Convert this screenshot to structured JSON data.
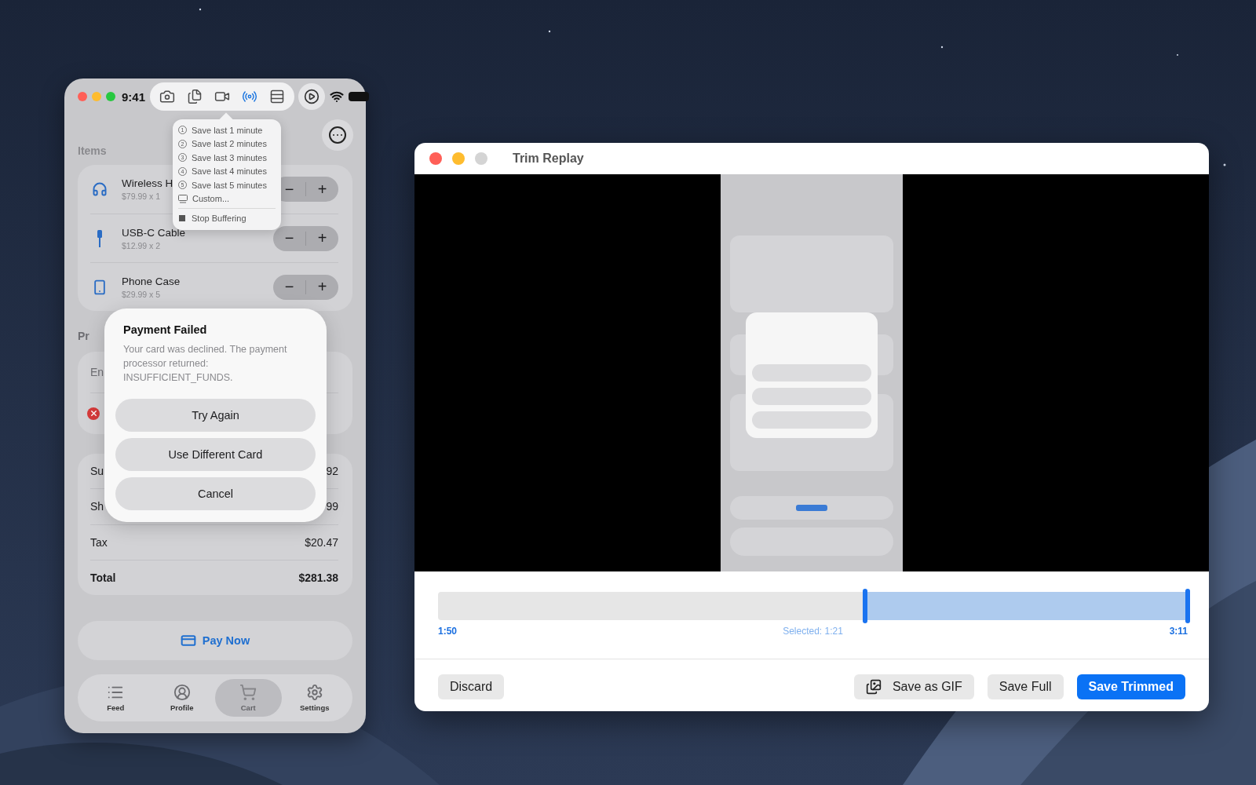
{
  "phone_window": {
    "lights": [
      {
        "color": "#ff5f57"
      },
      {
        "color": "#febc2e"
      },
      {
        "color": "#28c840"
      }
    ],
    "status_bar": {
      "time": "9:41"
    },
    "toolbar": {
      "tools": [
        {
          "kind": "camera",
          "selected": false
        },
        {
          "kind": "documents",
          "selected": false
        },
        {
          "kind": "video",
          "selected": false
        },
        {
          "kind": "broadcast",
          "selected": true
        },
        {
          "kind": "rows",
          "selected": false
        }
      ]
    },
    "buffer_menu": {
      "items": [
        {
          "kind": "duration",
          "marker": "1",
          "label": "Save last 1 minute"
        },
        {
          "kind": "duration",
          "marker": "2",
          "label": "Save last 2 minutes"
        },
        {
          "kind": "duration",
          "marker": "3",
          "label": "Save last 3 minutes"
        },
        {
          "kind": "duration",
          "marker": "4",
          "label": "Save last 4 minutes"
        },
        {
          "kind": "duration",
          "marker": "5",
          "label": "Save last 5 minutes"
        },
        {
          "kind": "custom",
          "label": "Custom..."
        },
        {
          "kind": "stop",
          "label": "Stop Buffering"
        }
      ]
    },
    "items_section": {
      "title": "Items",
      "items": [
        {
          "kind": "headphones",
          "name": "Wireless H",
          "price": "$79.99 x 1",
          "minus": "−",
          "plus": "+"
        },
        {
          "kind": "cable",
          "name": "USB-C Cable",
          "price": "$12.99 x 2",
          "minus": "−",
          "plus": "+"
        },
        {
          "kind": "phone",
          "name": "Phone Case",
          "price": "$29.99 x 5",
          "minus": "−",
          "plus": "+"
        }
      ]
    },
    "promo_section": {
      "title": "Pr",
      "field": {
        "placeholder": "En"
      }
    },
    "summary": {
      "rows": [
        {
          "kind": "plain",
          "label": "Su",
          "value": "92"
        },
        {
          "kind": "plain",
          "label": "Sh",
          "value": "99"
        },
        {
          "kind": "plain",
          "label": "Tax",
          "value": "$20.47"
        },
        {
          "kind": "total",
          "label": "Total",
          "value": "$281.38"
        }
      ]
    },
    "pay_button": {
      "label": "Pay Now"
    },
    "tabs": [
      {
        "kind": "feed",
        "label": "Feed",
        "selected": false
      },
      {
        "kind": "profile",
        "label": "Profile",
        "selected": false
      },
      {
        "kind": "cart",
        "label": "Cart",
        "selected": true
      },
      {
        "kind": "settings",
        "label": "Settings",
        "selected": false
      }
    ],
    "alert": {
      "title": "Payment Failed",
      "message": "Your card was declined. The payment processor returned: INSUFFICIENT_FUNDS.",
      "buttons": [
        "Try Again",
        "Use Different Card",
        "Cancel"
      ]
    }
  },
  "trim_window": {
    "lights": [
      {
        "color": "#ff5f57"
      },
      {
        "color": "#febc2e"
      },
      {
        "color": "#d4d4d4"
      }
    ],
    "title": "Trim Replay",
    "timeline": {
      "handles": [
        {
          "level": 0.57
        },
        {
          "level": 1
        }
      ],
      "start_label": "1:50",
      "selected_label": "Selected: 1:21",
      "end_label": "3:11"
    },
    "buttons": [
      {
        "kind": "plain",
        "label": "Discard"
      },
      {
        "kind": "gif",
        "label": "Save as GIF"
      },
      {
        "kind": "plain",
        "label": "Save Full"
      },
      {
        "kind": "primary",
        "label": "Save Trimmed"
      }
    ]
  }
}
